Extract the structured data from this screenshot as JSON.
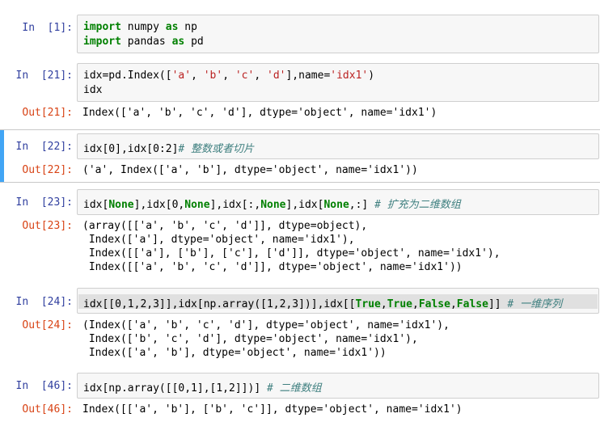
{
  "cells": [
    {
      "in_prompt": "In  [1]:",
      "input_lines": [
        [
          {
            "t": "import",
            "c": "kw"
          },
          {
            "t": " numpy ",
            "c": ""
          },
          {
            "t": "as",
            "c": "kw"
          },
          {
            "t": " np",
            "c": ""
          }
        ],
        [
          {
            "t": "import",
            "c": "kw"
          },
          {
            "t": " pandas ",
            "c": ""
          },
          {
            "t": "as",
            "c": "kw"
          },
          {
            "t": " pd",
            "c": ""
          }
        ]
      ]
    },
    {
      "in_prompt": "In  [21]:",
      "input_lines": [
        [
          {
            "t": "idx=pd.Index([",
            "c": ""
          },
          {
            "t": "'a'",
            "c": "str"
          },
          {
            "t": ", ",
            "c": ""
          },
          {
            "t": "'b'",
            "c": "str"
          },
          {
            "t": ", ",
            "c": ""
          },
          {
            "t": "'c'",
            "c": "str"
          },
          {
            "t": ", ",
            "c": ""
          },
          {
            "t": "'d'",
            "c": "str"
          },
          {
            "t": "],name=",
            "c": ""
          },
          {
            "t": "'idx1'",
            "c": "str"
          },
          {
            "t": ")",
            "c": ""
          }
        ],
        [
          {
            "t": "idx",
            "c": ""
          }
        ]
      ],
      "out_prompt": "Out[21]:",
      "output_lines": [
        "Index(['a', 'b', 'c', 'd'], dtype='object', name='idx1')"
      ]
    },
    {
      "in_prompt": "In  [22]:",
      "input_lines": [
        [
          {
            "t": "idx[0],idx[0:2]",
            "c": ""
          },
          {
            "t": "# 整数或者切片",
            "c": "cm"
          }
        ]
      ],
      "out_prompt": "Out[22]:",
      "output_lines": [
        "('a', Index(['a', 'b'], dtype='object', name='idx1'))"
      ]
    },
    {
      "in_prompt": "In  [23]:",
      "input_lines": [
        [
          {
            "t": "idx[",
            "c": ""
          },
          {
            "t": "None",
            "c": "kw"
          },
          {
            "t": "],idx[0,",
            "c": ""
          },
          {
            "t": "None",
            "c": "kw"
          },
          {
            "t": "],idx[:,",
            "c": ""
          },
          {
            "t": "None",
            "c": "kw"
          },
          {
            "t": "],idx[",
            "c": ""
          },
          {
            "t": "None",
            "c": "kw"
          },
          {
            "t": ",:] ",
            "c": ""
          },
          {
            "t": "# 扩充为二维数组",
            "c": "cm"
          }
        ]
      ],
      "out_prompt": "Out[23]:",
      "output_lines": [
        "(array([['a', 'b', 'c', 'd']], dtype=object),",
        " Index(['a'], dtype='object', name='idx1'),",
        " Index([['a'], ['b'], ['c'], ['d']], dtype='object', name='idx1'),",
        " Index([['a', 'b', 'c', 'd']], dtype='object', name='idx1'))"
      ]
    },
    {
      "in_prompt": "In  [24]:",
      "input_lines": [
        [
          {
            "t": "idx[[0,1,2,3]],idx[np.array([1,2,3])],idx[[",
            "c": ""
          },
          {
            "t": "True",
            "c": "kw"
          },
          {
            "t": ",",
            "c": ""
          },
          {
            "t": "True",
            "c": "kw"
          },
          {
            "t": ",",
            "c": ""
          },
          {
            "t": "False",
            "c": "kw"
          },
          {
            "t": ",",
            "c": ""
          },
          {
            "t": "False",
            "c": "kw"
          },
          {
            "t": "]] ",
            "c": ""
          },
          {
            "t": "# 一维序列",
            "c": "cm"
          }
        ]
      ],
      "out_prompt": "Out[24]:",
      "output_lines": [
        "(Index(['a', 'b', 'c', 'd'], dtype='object', name='idx1'),",
        " Index(['b', 'c', 'd'], dtype='object', name='idx1'),",
        " Index(['a', 'b'], dtype='object', name='idx1'))"
      ]
    },
    {
      "in_prompt": "In  [46]:",
      "input_lines": [
        [
          {
            "t": "idx[np.array([[0,1],[1,2]])] ",
            "c": ""
          },
          {
            "t": "# 二维数组",
            "c": "cm"
          }
        ]
      ],
      "out_prompt": "Out[46]:",
      "output_lines": [
        "Index([['a', 'b'], ['b', 'c']], dtype='object', name='idx1')"
      ]
    }
  ]
}
